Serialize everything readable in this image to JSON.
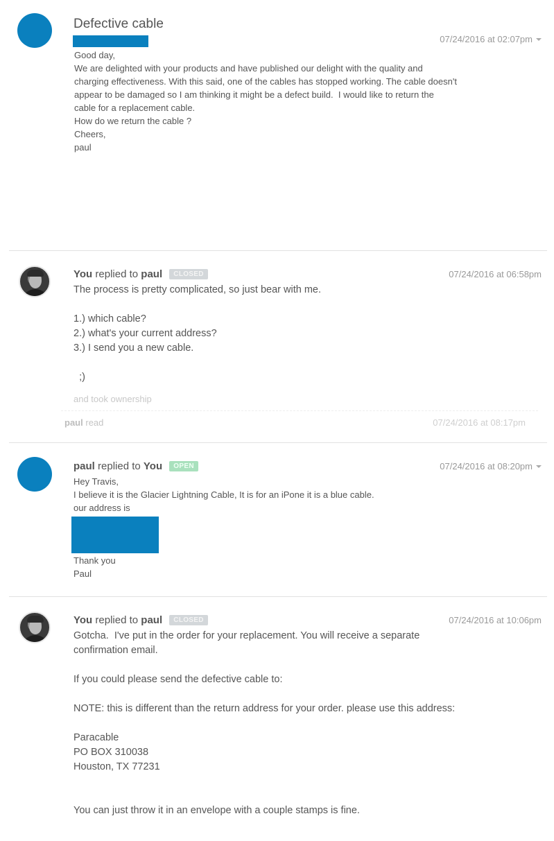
{
  "colors": {
    "accent_blue": "#0a80be",
    "badge_closed": "#d3d7da",
    "badge_open": "#a9e1bd",
    "divider": "#e1e1e1",
    "text": "#555555",
    "muted": "#999999"
  },
  "ticket": {
    "subject": "Defective cable"
  },
  "messages": [
    {
      "author": "paul",
      "avatar": "blue-placeholder-avatar",
      "timestamp": "07/24/2016 at 02:07pm",
      "has_menu": true,
      "body": "Good day,\nWe are delighted with your products and have published our delight with the quality and\ncharging effectiveness. With this said, one of the cables has stopped working. The cable doesn't\nappear to be damaged so I am thinking it might be a defect build.  I would like to return the\ncable for a replacement cable.\nHow do we return the cable ?\nCheers,\npaul"
    },
    {
      "author": "You",
      "verb": "replied to",
      "recipient": "paul",
      "status": "CLOSED",
      "avatar": "agent-photo-avatar",
      "timestamp": "07/24/2016 at 06:58pm",
      "body": "The process is pretty complicated, so just bear with me.\n\n1.) which cable?\n2.) what's your current address?\n3.) I send you a new cable.\n\n  ;)",
      "note": "and took ownership",
      "read_receipt": {
        "who": "paul",
        "action": "read",
        "timestamp": "07/24/2016 at 08:17pm"
      }
    },
    {
      "author": "paul",
      "verb": "replied to",
      "recipient": "You",
      "status": "OPEN",
      "avatar": "blue-placeholder-avatar",
      "timestamp": "07/24/2016 at 08:20pm",
      "has_menu": true,
      "body_before": "Hey Travis,\nI believe it is the Glacier Lightning Cable, It is for an iPone it is a blue cable.\nour address is",
      "body_after": "Thank you\nPaul"
    },
    {
      "author": "You",
      "verb": "replied to",
      "recipient": "paul",
      "status": "CLOSED",
      "avatar": "agent-photo-avatar",
      "timestamp": "07/24/2016 at 10:06pm",
      "body": "Gotcha.  I've put in the order for your replacement. You will receive a separate\nconfirmation email.\n\nIf you could please send the defective cable to:\n\nNOTE: this is different than the return address for your order. please use this address:\n\nParacable\nPO BOX 310038\nHouston, TX 77231\n\n\nYou can just throw it in an envelope with a couple stamps is fine."
    }
  ]
}
